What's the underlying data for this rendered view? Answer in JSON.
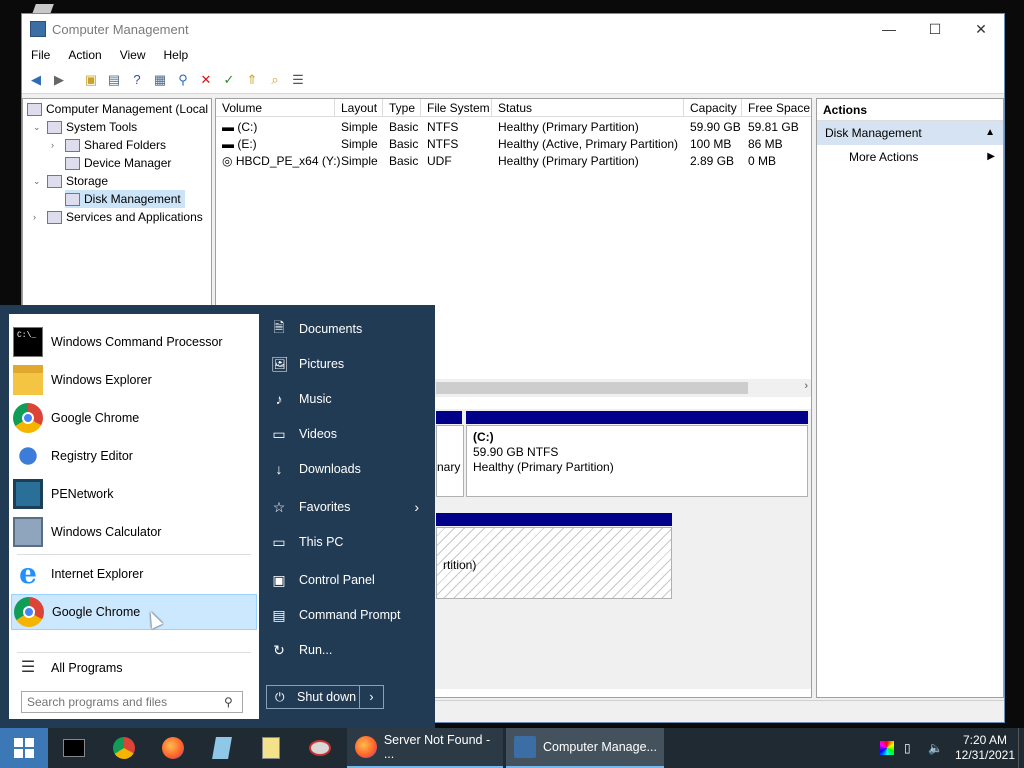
{
  "window": {
    "title": "Computer Management",
    "minimize": "—",
    "maximize": "☐",
    "close": "✕"
  },
  "menu": [
    "File",
    "Action",
    "View",
    "Help"
  ],
  "tree": {
    "root": "Computer Management (Local",
    "system_tools": "System Tools",
    "shared_folders": "Shared Folders",
    "device_manager": "Device Manager",
    "storage": "Storage",
    "disk_management": "Disk Management",
    "services": "Services and Applications"
  },
  "volume_table": {
    "columns": [
      "Volume",
      "Layout",
      "Type",
      "File System",
      "Status",
      "Capacity",
      "Free Space"
    ],
    "rows": [
      [
        "(C:)",
        "Simple",
        "Basic",
        "NTFS",
        "Healthy (Primary Partition)",
        "59.90 GB",
        "59.81 GB"
      ],
      [
        "(E:)",
        "Simple",
        "Basic",
        "NTFS",
        "Healthy (Active, Primary Partition)",
        "100 MB",
        "86 MB"
      ],
      [
        "HBCD_PE_x64 (Y:)",
        "Simple",
        "Basic",
        "UDF",
        "Healthy (Primary Partition)",
        "2.89 GB",
        "0 MB"
      ]
    ]
  },
  "disk_view": {
    "c_label": "(C:)",
    "c_size": "59.90 GB NTFS",
    "c_status": "Healthy (Primary Partition)",
    "e_partial": "nary",
    "partial_status": "rtition)"
  },
  "actions": {
    "title": "Actions",
    "section": "Disk Management",
    "more": "More Actions"
  },
  "start_menu": {
    "programs": [
      {
        "label": "Windows Command Processor",
        "icon": "cmd-icon",
        "color": "#000000"
      },
      {
        "label": "Windows Explorer",
        "icon": "folder-icon",
        "color": "#f4c542"
      },
      {
        "label": "Google Chrome",
        "icon": "chrome-icon",
        "color": "#db4437"
      },
      {
        "label": "Registry Editor",
        "icon": "registry-icon",
        "color": "#3b7dd8"
      },
      {
        "label": "PENetwork",
        "icon": "network-icon",
        "color": "#2a6f97"
      },
      {
        "label": "Windows Calculator",
        "icon": "calculator-icon",
        "color": "#8fa5bd"
      },
      {
        "label": "Internet Explorer",
        "icon": "ie-icon",
        "color": "#1e90ff"
      },
      {
        "label": "Google Chrome",
        "icon": "chrome-icon",
        "color": "#db4437"
      }
    ],
    "all_programs": "All Programs",
    "search_placeholder": "Search programs and files",
    "places": [
      {
        "label": "Documents",
        "icon": "document-icon",
        "glyph": "🗎"
      },
      {
        "label": "Pictures",
        "icon": "picture-icon",
        "glyph": "🖼"
      },
      {
        "label": "Music",
        "icon": "music-icon",
        "glyph": "♪"
      },
      {
        "label": "Videos",
        "icon": "video-icon",
        "glyph": "▭"
      },
      {
        "label": "Downloads",
        "icon": "download-icon",
        "glyph": "↓"
      },
      {
        "label": "Favorites",
        "icon": "star-icon",
        "glyph": "☆"
      },
      {
        "label": "This PC",
        "icon": "monitor-icon",
        "glyph": "▭"
      },
      {
        "label": "Control Panel",
        "icon": "control-panel-icon",
        "glyph": "▣"
      },
      {
        "label": "Command Prompt",
        "icon": "terminal-icon",
        "glyph": "▤"
      },
      {
        "label": "Run...",
        "icon": "run-icon",
        "glyph": "↻"
      }
    ],
    "shutdown": "Shut down"
  },
  "taskbar": {
    "tasks": [
      {
        "label": "Server Not Found - ...",
        "icon": "firefox-icon"
      },
      {
        "label": "Computer Manage...",
        "icon": "computer-management-icon"
      }
    ],
    "time": "7:20 AM",
    "date": "12/31/2021"
  },
  "colors": {
    "start_menu_bg": "#223b55",
    "disk_header": "#00008b",
    "selection": "#cce4f7"
  }
}
